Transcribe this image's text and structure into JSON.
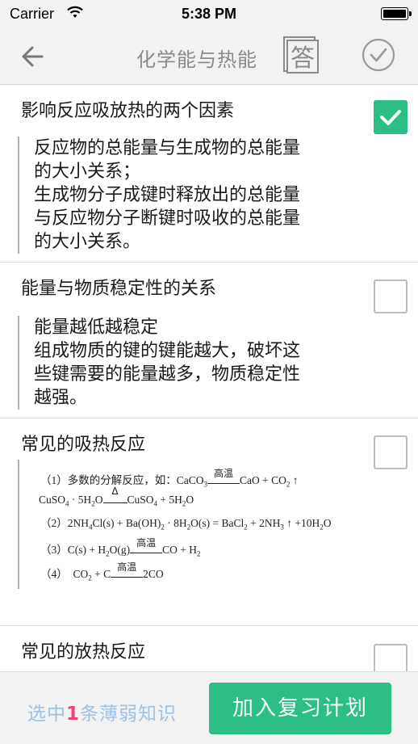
{
  "status": {
    "carrier": "Carrier",
    "time": "5:38 PM"
  },
  "nav": {
    "title": "化学能与热能",
    "answer_label": "答"
  },
  "items": [
    {
      "title": "影响反应吸放热的两个因素",
      "checked": true,
      "lines": [
        "反应物的总能量与生成物的总能量",
        "的大小关系；",
        "生成物分子成键时释放出的总能量",
        "与反应物分子断键时吸收的总能量",
        "的大小关系。"
      ]
    },
    {
      "title": "能量与物质稳定性的关系",
      "checked": false,
      "lines": [
        "能量越低越稳定",
        "组成物质的键的键能越大，破坏这",
        "些键需要的能量越多，物质稳定性",
        "越强。"
      ]
    },
    {
      "title": "常见的吸热反应",
      "checked": false,
      "formula": {
        "l1_prefix": "（1）多数的分解反应，如：CaCO",
        "l1_cond": "高温",
        "l1_product": "CaO + CO",
        "l2_left": "CuSO",
        "l2_cond": "Δ",
        "l3": "（2）2NH",
        "l4_prefix": "（3）C(s) + H",
        "l4_cond": "高温",
        "l5_prefix": "（4）",
        "l5_cond": "高温"
      }
    },
    {
      "title": "常见的放热反应",
      "checked": false
    }
  ],
  "bottom": {
    "selected_prefix": "选中",
    "selected_count": "1",
    "selected_suffix": "条薄弱知识",
    "add_button": "加入复习计划"
  },
  "colors": {
    "accent_green": "#2bbf85",
    "count_pink": "#e8457f",
    "hint_blue": "#9fc3e0"
  }
}
